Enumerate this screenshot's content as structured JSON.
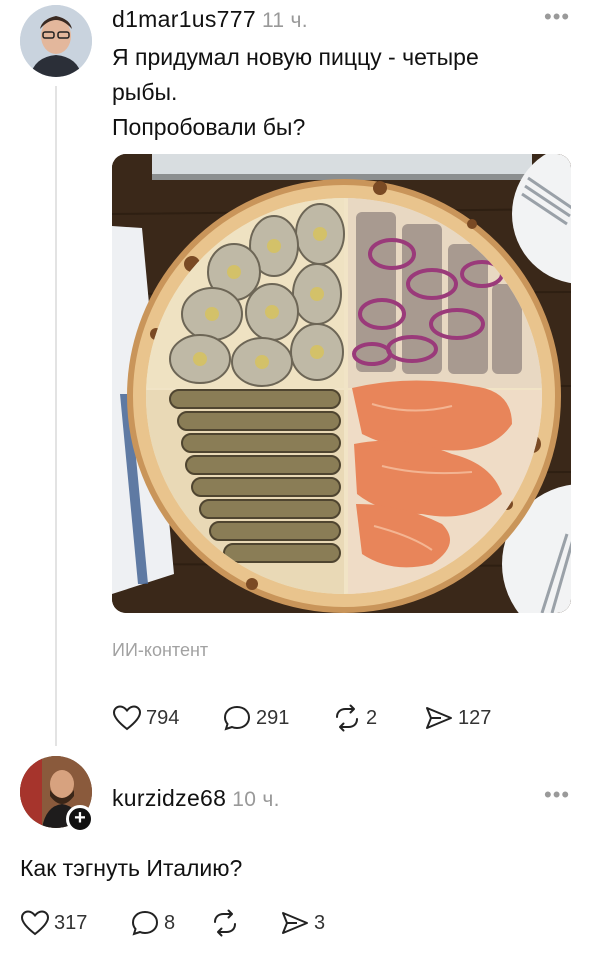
{
  "post": {
    "username": "d1mar1us777",
    "time": "11 ч.",
    "more": "•••",
    "text_lines": [
      "Я придумал новую пиццу - четыре",
      "рыбы.",
      "Попробовали бы?"
    ],
    "media_label": "ИИ-контент",
    "actions": {
      "likes": "794",
      "comments": "291",
      "reposts": "2",
      "shares": "127"
    }
  },
  "reply": {
    "username": "kurzidze68",
    "time": "10 ч.",
    "more": "•••",
    "follow_badge": "+",
    "text": "Как тэгнуть Италию?",
    "actions": {
      "likes": "317",
      "comments": "8",
      "reposts": "",
      "shares": "3"
    }
  },
  "colors": {
    "text": "#111111",
    "muted": "#999999",
    "thread_line": "#e3e3e3"
  }
}
